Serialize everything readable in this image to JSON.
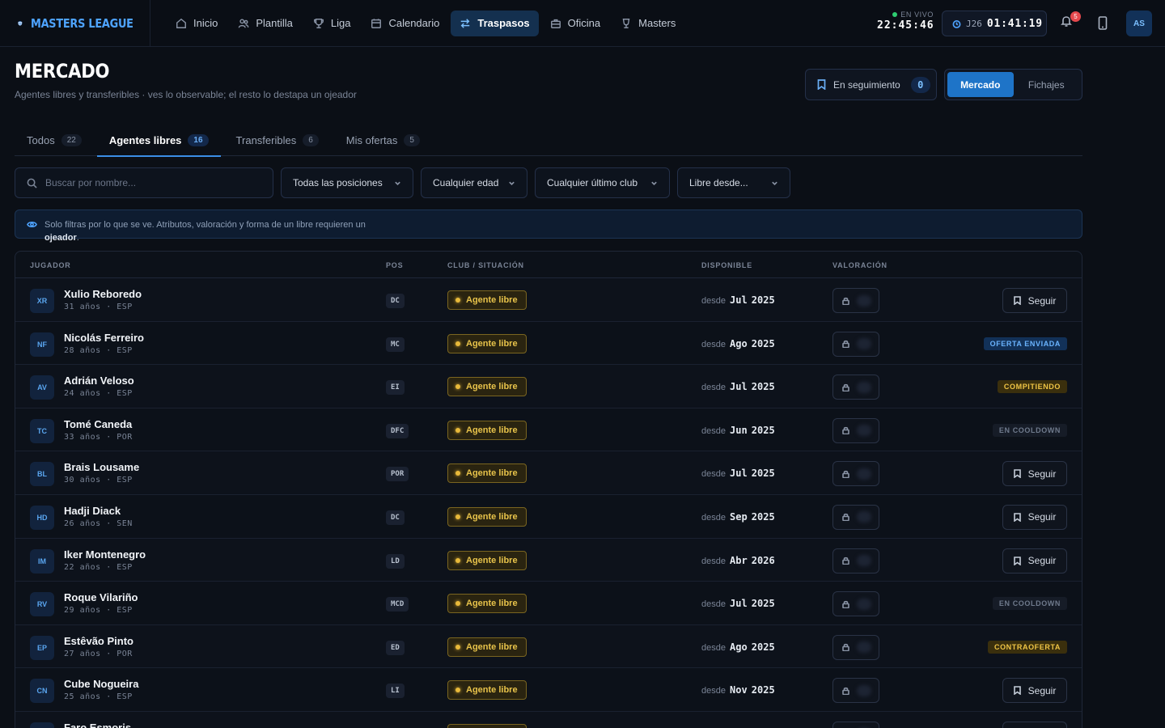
{
  "brand": {
    "name": "MASTERS LEAGUE"
  },
  "nav": [
    {
      "label": "Inicio",
      "icon": "home-icon",
      "active": false
    },
    {
      "label": "Plantilla",
      "icon": "users-icon",
      "active": false
    },
    {
      "label": "Liga",
      "icon": "trophy-icon",
      "active": false
    },
    {
      "label": "Calendario",
      "icon": "calendar-icon",
      "active": false
    },
    {
      "label": "Traspasos",
      "icon": "swap-icon",
      "active": true
    },
    {
      "label": "Oficina",
      "icon": "briefcase-icon",
      "active": false
    },
    {
      "label": "Masters",
      "icon": "cup-icon",
      "active": false
    }
  ],
  "status": {
    "live_label": "EN VIVO",
    "live_time": "22:45:46",
    "jornada_label": "J26",
    "jornada_time": "01:41:19",
    "notifications": "5",
    "user_initials": "AS"
  },
  "header": {
    "title": "MERCADO",
    "subtitle": "Agentes libres y transferibles · ves lo observable; el resto lo destapa un ojeador",
    "follow_label": "En seguimiento",
    "follow_count": "0",
    "seg_market": "Mercado",
    "seg_signings": "Fichajes"
  },
  "tabs": [
    {
      "label": "Todos",
      "count": "22",
      "active": false
    },
    {
      "label": "Agentes libres",
      "count": "16",
      "active": true
    },
    {
      "label": "Transferibles",
      "count": "6",
      "active": false
    },
    {
      "label": "Mis ofertas",
      "count": "5",
      "active": false
    }
  ],
  "filters": {
    "search_placeholder": "Buscar por nombre...",
    "position": "Todas las posiciones",
    "age": "Cualquier edad",
    "last_club": "Cualquier último club",
    "free_since": "Libre desde..."
  },
  "notice": {
    "text": "Solo filtras por lo que se ve. Atributos, valoración y forma de un libre requieren un",
    "strong": "ojeador",
    "end": "."
  },
  "table": {
    "headers": {
      "player": "JUGADOR",
      "pos": "POS",
      "club": "CLUB / SITUACIÓN",
      "available": "DISPONIBLE",
      "rating": "VALORACIÓN"
    },
    "since_label": "desde",
    "age_unit": "años",
    "rows": [
      {
        "initials": "XR",
        "name": "Xulio Reboredo",
        "age": "31",
        "country": "ESP",
        "pos": "DC",
        "status": "Agente libre",
        "month": "Jul",
        "year": "2025",
        "action": "button",
        "action_label": "Seguir"
      },
      {
        "initials": "NF",
        "name": "Nicolás Ferreiro",
        "age": "28",
        "country": "ESP",
        "pos": "MC",
        "status": "Agente libre",
        "month": "Ago",
        "year": "2025",
        "action": "oferta",
        "action_label": "OFERTA ENVIADA"
      },
      {
        "initials": "AV",
        "name": "Adrián Veloso",
        "age": "24",
        "country": "ESP",
        "pos": "EI",
        "status": "Agente libre",
        "month": "Jul",
        "year": "2025",
        "action": "compitiendo",
        "action_label": "COMPITIENDO"
      },
      {
        "initials": "TC",
        "name": "Tomé Caneda",
        "age": "33",
        "country": "POR",
        "pos": "DFC",
        "status": "Agente libre",
        "month": "Jun",
        "year": "2025",
        "action": "cooldown",
        "action_label": "EN COOLDOWN"
      },
      {
        "initials": "BL",
        "name": "Brais Lousame",
        "age": "30",
        "country": "ESP",
        "pos": "POR",
        "status": "Agente libre",
        "month": "Jul",
        "year": "2025",
        "action": "button",
        "action_label": "Seguir"
      },
      {
        "initials": "HD",
        "name": "Hadji Diack",
        "age": "26",
        "country": "SEN",
        "pos": "DC",
        "status": "Agente libre",
        "month": "Sep",
        "year": "2025",
        "action": "button",
        "action_label": "Seguir"
      },
      {
        "initials": "IM",
        "name": "Iker Montenegro",
        "age": "22",
        "country": "ESP",
        "pos": "LD",
        "status": "Agente libre",
        "month": "Abr",
        "year": "2026",
        "action": "button",
        "action_label": "Seguir"
      },
      {
        "initials": "RV",
        "name": "Roque Vilariño",
        "age": "29",
        "country": "ESP",
        "pos": "MCD",
        "status": "Agente libre",
        "month": "Jul",
        "year": "2025",
        "action": "cooldown",
        "action_label": "EN COOLDOWN"
      },
      {
        "initials": "EP",
        "name": "Estêvão Pinto",
        "age": "27",
        "country": "POR",
        "pos": "ED",
        "status": "Agente libre",
        "month": "Ago",
        "year": "2025",
        "action": "contra",
        "action_label": "CONTRAOFERTA"
      },
      {
        "initials": "CN",
        "name": "Cube Nogueira",
        "age": "25",
        "country": "ESP",
        "pos": "LI",
        "status": "Agente libre",
        "month": "Nov",
        "year": "2025",
        "action": "button",
        "action_label": "Seguir"
      },
      {
        "initials": "FE",
        "name": "Faro Esmoris",
        "age": "",
        "country": "",
        "pos": "",
        "status": "Agente libre",
        "month": "",
        "year": "",
        "action": "button",
        "action_label": "Seguir"
      }
    ]
  }
}
